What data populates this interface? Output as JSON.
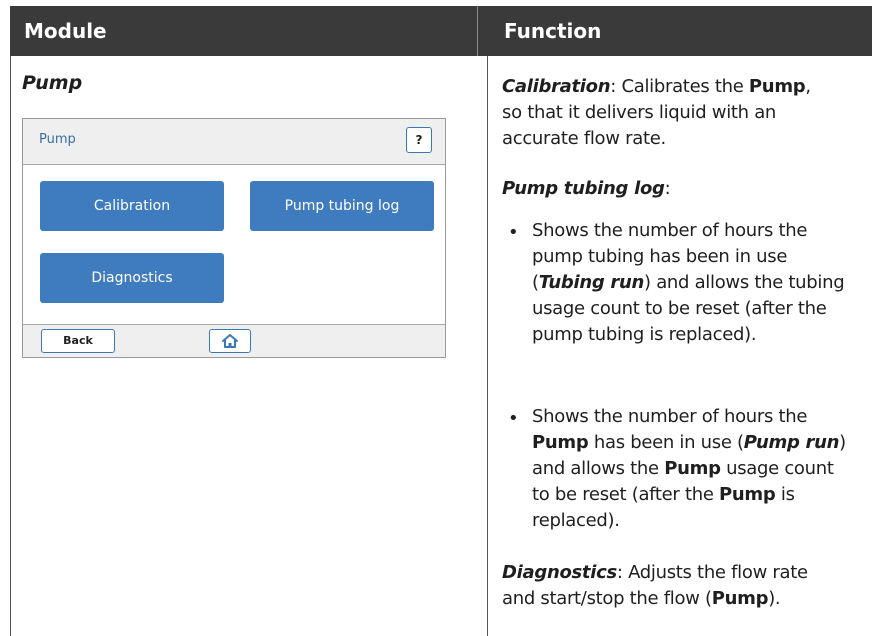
{
  "table": {
    "header_module": "Module",
    "header_function": "Function"
  },
  "module": {
    "name": "Pump"
  },
  "screen": {
    "title": "Pump",
    "help_label": "?",
    "buttons": {
      "calibration": "Calibration",
      "pump_tubing_log": "Pump tubing log",
      "diagnostics": "Diagnostics"
    },
    "footer": {
      "back": "Back",
      "home_icon": "home-icon"
    }
  },
  "function": {
    "calibration": {
      "term": "Calibration",
      "t1": ": Calibrates the ",
      "b1": "Pump",
      "t2": ", so that it delivers liquid with an accurate flow rate."
    },
    "pump_tubing_log": {
      "term": "Pump tubing log",
      "t1": ":"
    },
    "bullet1": {
      "t1": "Shows the number of hours the pump tubing has been in use (",
      "em1": "Tubing run",
      "t2": ") and allows the tubing usage count to be reset (after the pump tubing is replaced)."
    },
    "bullet2": {
      "t1": "Shows the number of hours the ",
      "b1": "Pump",
      "t2": " has been in use (",
      "em1": "Pump run",
      "t3": ") and allows the ",
      "b2": "Pump",
      "t4": " usage count to be reset (after the ",
      "b3": "Pump",
      "t5": " is replaced)."
    },
    "diagnostics": {
      "term": "Diagnostics",
      "t1": ": Adjusts the flow rate and start/stop the flow (",
      "b1": "Pump",
      "t2": ")."
    },
    "bullet_char": "•"
  }
}
